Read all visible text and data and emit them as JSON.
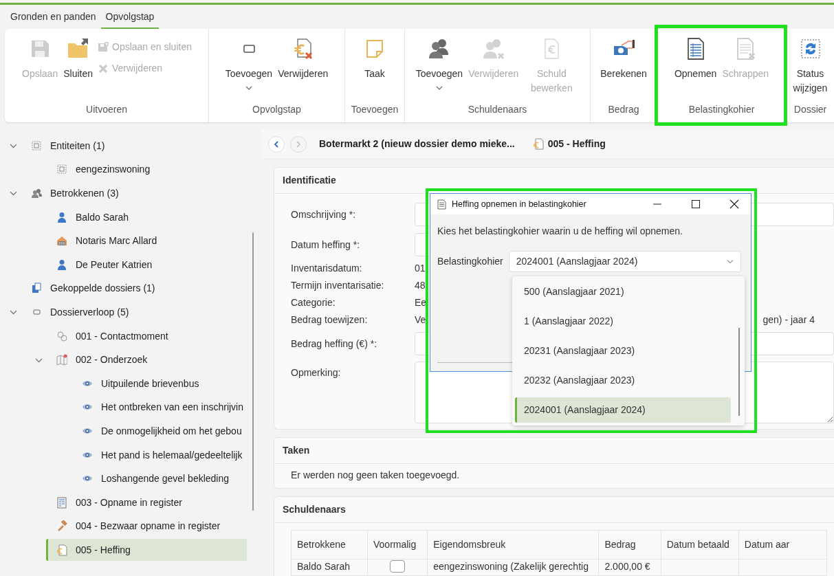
{
  "ribbon": {
    "tabs": [
      {
        "label": "Gronden en panden",
        "selected": false
      },
      {
        "label": "Opvolgstap",
        "selected": true
      }
    ],
    "groups": [
      {
        "label": "Uitvoeren",
        "highlighted": false,
        "buttons": [
          {
            "kind": "save",
            "label": "Opslaan",
            "disabled": true,
            "has_menu": false
          },
          {
            "kind": "folder",
            "label": "Sluiten",
            "disabled": false,
            "has_menu": false
          }
        ],
        "small_buttons": [
          {
            "kind": "save-small",
            "label": "Opslaan en sluiten",
            "disabled": true
          },
          {
            "kind": "cross-small",
            "label": "Verwijderen",
            "disabled": true
          }
        ]
      },
      {
        "label": "Opvolgstap",
        "highlighted": false,
        "buttons": [
          {
            "kind": "frame",
            "label": "Toevoegen",
            "disabled": false,
            "has_menu": true
          },
          {
            "kind": "euro-doc-cross",
            "label": "Verwijderen",
            "disabled": false,
            "has_menu": false
          }
        ]
      },
      {
        "label": "Toevoegen",
        "highlighted": false,
        "buttons": [
          {
            "kind": "note",
            "label": "Taak",
            "disabled": false,
            "has_menu": false
          }
        ]
      },
      {
        "label": "Schuldenaars",
        "highlighted": false,
        "buttons": [
          {
            "kind": "people",
            "label": "Toevoegen",
            "disabled": false,
            "has_menu": true
          },
          {
            "kind": "people-cross",
            "label": "Verwijderen",
            "disabled": true,
            "has_menu": false
          },
          {
            "kind": "euro-doc",
            "label": "Schuld bewerken",
            "disabled": true,
            "has_menu": false
          }
        ]
      },
      {
        "label": "Bedrag",
        "highlighted": false,
        "buttons": [
          {
            "kind": "money",
            "label": "Berekenen",
            "disabled": false,
            "has_menu": false
          }
        ]
      },
      {
        "label": "Belastingkohier",
        "highlighted": true,
        "buttons": [
          {
            "kind": "list-doc",
            "label": "Opnemen",
            "disabled": false,
            "has_menu": false
          },
          {
            "kind": "list-doc-cross",
            "label": "Schrappen",
            "disabled": true,
            "has_menu": false
          }
        ]
      },
      {
        "label": "Dossier",
        "highlighted": false,
        "buttons": [
          {
            "kind": "refresh",
            "label": "Status wijzigen",
            "disabled": false,
            "has_menu": false
          }
        ]
      }
    ]
  },
  "tree": [
    {
      "kind": "entity",
      "label": "Entiteiten (1)",
      "selected": false,
      "expanded": true,
      "children": [
        {
          "kind": "entity",
          "label": "eengezinswoning",
          "selected": false
        }
      ]
    },
    {
      "kind": "people",
      "label": "Betrokkenen (3)",
      "selected": false,
      "expanded": true,
      "children": [
        {
          "kind": "person",
          "label": "Baldo Sarah",
          "selected": false
        },
        {
          "kind": "notary",
          "label": "Notaris Marc Allard",
          "selected": false
        },
        {
          "kind": "person",
          "label": "De Peuter Katrien",
          "selected": false
        }
      ]
    },
    {
      "kind": "linked",
      "label": "Gekoppelde dossiers (1)",
      "selected": false
    },
    {
      "kind": "history",
      "label": "Dossierverloop (5)",
      "selected": false,
      "expanded": true,
      "children": [
        {
          "kind": "contact",
          "label": "001 - Contactmoment",
          "selected": false
        },
        {
          "kind": "research",
          "label": "002 - Onderzoek",
          "selected": false,
          "expanded": true,
          "children": [
            {
              "kind": "observation",
              "label": "Uitpuilende brievenbus",
              "selected": false
            },
            {
              "kind": "observation",
              "label": "Het ontbreken van een inschrijvin",
              "selected": false
            },
            {
              "kind": "observation",
              "label": "De onmogelijkheid om het gebou",
              "selected": false
            },
            {
              "kind": "observation",
              "label": "Het pand is helemaal/gedeeltelijk",
              "selected": false
            },
            {
              "kind": "observation",
              "label": "Loshangende gevel bekleding",
              "selected": false
            }
          ]
        },
        {
          "kind": "register",
          "label": "003 - Opname in register",
          "selected": false
        },
        {
          "kind": "objection",
          "label": "004 - Bezwaar opname in register",
          "selected": false
        },
        {
          "kind": "levy",
          "label": "005 - Heffing",
          "selected": true
        }
      ]
    }
  ],
  "breadcrumb": {
    "dossier": "Botermarkt 2 (nieuw dossier demo mieke...",
    "step": "005 - Heffing"
  },
  "identificatie": {
    "title": "Identificatie",
    "fields": [
      {
        "kind": "input",
        "label": "Omschrijving *:"
      },
      {
        "kind": "date",
        "label": "Datum heffing *:"
      },
      {
        "kind": "text",
        "label": "Inventarisdatum:",
        "value": "01"
      },
      {
        "kind": "text",
        "label": "Termijn inventarisatie:",
        "value": "48"
      },
      {
        "kind": "text",
        "label": "Categorie:",
        "value": "Ee"
      },
      {
        "kind": "text",
        "label": "Bedrag toewijzen:",
        "value": "Ve",
        "value_tail": "gen) - jaar 4"
      },
      {
        "kind": "input",
        "label": "Bedrag heffing (€) *:"
      },
      {
        "kind": "textarea",
        "label": "Opmerking:"
      }
    ]
  },
  "taken": {
    "title": "Taken",
    "message": "Er werden nog geen taken toegevoegd."
  },
  "schuldenaars": {
    "title": "Schuldenaars",
    "columns": [
      "Betrokkene",
      "Voormalig",
      "Eigendomsbreuk",
      "Bedrag",
      "Datum betaald",
      "Datum aar"
    ],
    "rows": [
      {
        "betrokkene": "Baldo Sarah",
        "voormalig": false,
        "eigendomsbreuk": "eengezinswoning (Zakelijk gerechtig",
        "bedrag": "2.000,00 €"
      }
    ]
  },
  "dialog": {
    "title": "Heffing opnemen in belastingkohier",
    "highlighted": true,
    "prompt": "Kies het belastingkohier waarin u de heffing wil opnemen.",
    "select_label": "Belastingkohier",
    "select_value": "2024001 (Aanslagjaar 2024)",
    "options": [
      {
        "label": "500 (Aanslagjaar 2021)",
        "selected": false
      },
      {
        "label": "1 (Aanslagjaar 2022)",
        "selected": false
      },
      {
        "label": "20231 (Aanslagjaar 2023)",
        "selected": false
      },
      {
        "label": "20232 (Aanslagjaar 2023)",
        "selected": false
      },
      {
        "label": "2024001 (Aanslagjaar 2024)",
        "selected": true
      }
    ]
  }
}
